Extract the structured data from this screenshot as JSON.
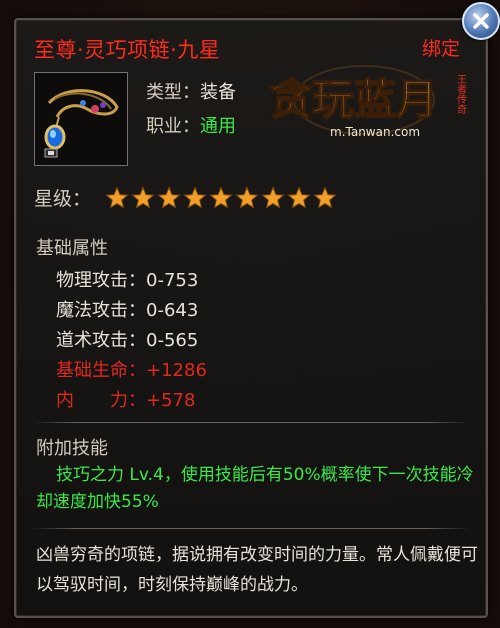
{
  "item": {
    "name": "至尊·灵巧项链·九星",
    "bound_label": "绑定",
    "type_label": "类型",
    "type_value": "装备",
    "job_label": "职业",
    "job_value": "通用",
    "icon_name": "necklace-icon"
  },
  "logo": {
    "main": "贪玩蓝月",
    "side": "王者传奇",
    "url": "m.Tanwan.com"
  },
  "stars": {
    "label": "星级",
    "count": 9,
    "color": "#f2a02a"
  },
  "base_attrs": {
    "title": "基础属性",
    "rows": [
      {
        "label": "物理攻击",
        "value": "0-753",
        "highlight": false
      },
      {
        "label": "魔法攻击",
        "value": "0-643",
        "highlight": false
      },
      {
        "label": "道术攻击",
        "value": "0-565",
        "highlight": false
      },
      {
        "label": "基础生命",
        "value": "+1286",
        "highlight": true
      },
      {
        "label": "内　　力",
        "value": "+578",
        "highlight": true
      }
    ]
  },
  "skill": {
    "title": "附加技能",
    "text": "技巧之力 Lv.4，使用技能后有50%概率使下一次技能冷却速度加快55%"
  },
  "description": "凶兽穷奇的项链，据说拥有改变时间的力量。常人佩戴便可以驾驭时间，时刻保持巅峰的战力。",
  "colors": {
    "title_red": "#ff2a1e",
    "green": "#3ae84a",
    "attr_red": "#e0281e"
  }
}
